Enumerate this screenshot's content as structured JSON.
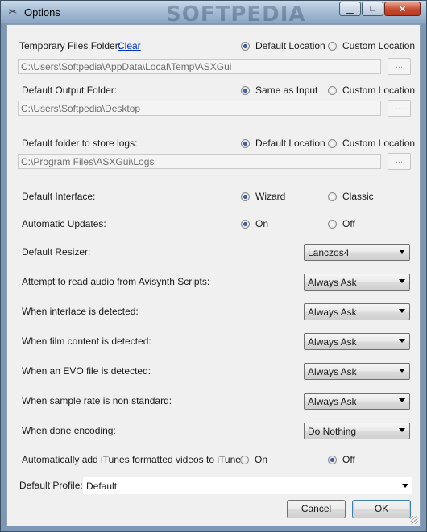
{
  "window": {
    "title": "Options",
    "watermark": "SOFTPEDIA"
  },
  "title_buttons": {
    "minimize": "▁",
    "maximize": "□",
    "close": "✕"
  },
  "temp": {
    "label": "Temporary Files Folder:",
    "link": "Clear",
    "opt1": "Default Location",
    "opt2": "Custom Location",
    "selected": "opt1",
    "path": "C:\\Users\\Softpedia\\AppData\\Local\\Temp\\ASXGui",
    "browse": "..."
  },
  "output": {
    "label": "Default Output Folder:",
    "opt1": "Same as Input",
    "opt2": "Custom Location",
    "selected": "opt1",
    "path": "C:\\Users\\Softpedia\\Desktop",
    "browse": "..."
  },
  "logs": {
    "label": "Default folder to store logs:",
    "opt1": "Default Location",
    "opt2": "Custom Location",
    "selected": "opt1",
    "path": "C:\\Program Files\\ASXGui\\Logs",
    "browse": "..."
  },
  "interface": {
    "label": "Default Interface:",
    "opt1": "Wizard",
    "opt2": "Classic",
    "selected": "opt1"
  },
  "updates": {
    "label": "Automatic Updates:",
    "opt1": "On",
    "opt2": "Off",
    "selected": "opt1"
  },
  "resizer": {
    "label": "Default Resizer:",
    "value": "Lanczos4"
  },
  "audio": {
    "label": "Attempt to read audio from Avisynth Scripts:",
    "value": "Always Ask"
  },
  "interlace": {
    "label": "When interlace is detected:",
    "value": "Always Ask"
  },
  "film": {
    "label": "When film content is detected:",
    "value": "Always Ask"
  },
  "evo": {
    "label": "When an EVO file is detected:",
    "value": "Always Ask"
  },
  "samplerate": {
    "label": "When sample rate is non standard:",
    "value": "Always Ask"
  },
  "done": {
    "label": "When done encoding:",
    "value": "Do Nothing"
  },
  "itunes": {
    "label": "Automatically add iTunes formatted videos to iTunes:",
    "opt1": "On",
    "opt2": "Off",
    "selected": "opt2"
  },
  "profile": {
    "label": "Default Profile:",
    "value": "Default"
  },
  "buttons": {
    "cancel": "Cancel",
    "ok": "OK"
  }
}
